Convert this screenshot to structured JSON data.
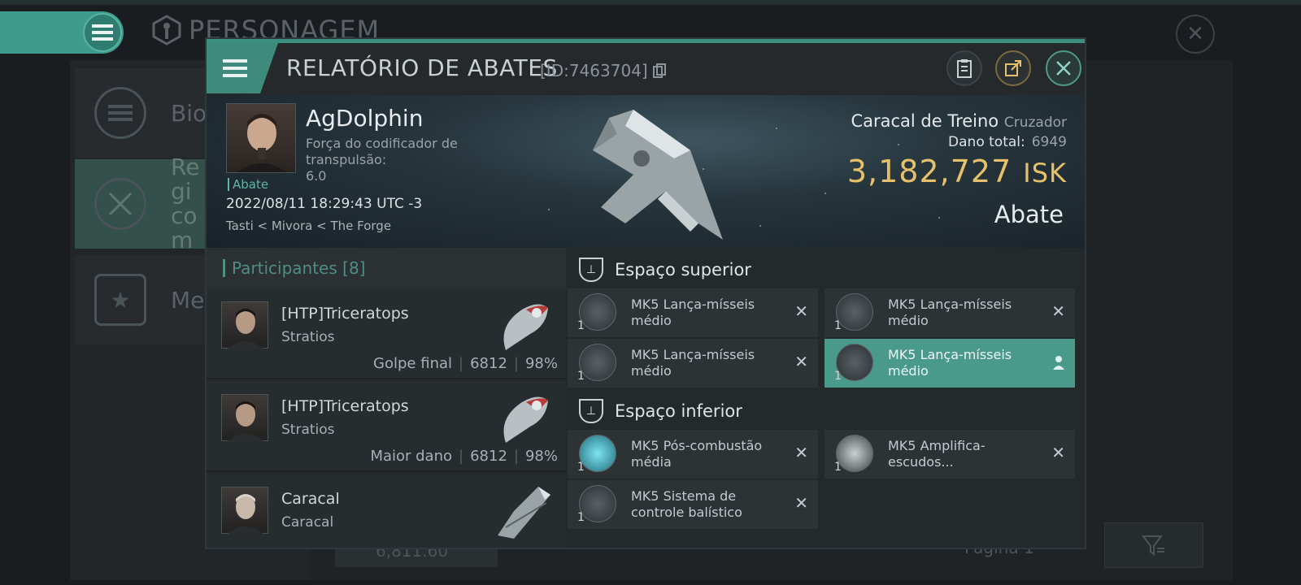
{
  "background": {
    "title": "PERSONAGEM",
    "side_items": [
      {
        "label": "Biog",
        "icon": "list-icon"
      },
      {
        "label": "Regi com",
        "icon": "swords-icon"
      },
      {
        "label": "Meda",
        "icon": "star-badge-icon"
      }
    ],
    "footer_value": "6,811.60",
    "page_label": "Página 1"
  },
  "dialog": {
    "title": "RELATÓRIO DE ABATES",
    "id_label": "[ID:7463704]",
    "victim": {
      "name": "AgDolphin",
      "strength_label": "Força do codificador de transpulsão:",
      "strength_value": "6.0",
      "tag": "Abate",
      "date": "2022/08/11 18:29:43 UTC -3",
      "location": "Tasti < Mivora < The Forge"
    },
    "ship": {
      "name": "Caracal de Treino",
      "class": "Cruzador",
      "damage_label": "Dano total:",
      "damage_value": "6949",
      "isk_value": "3,182,727",
      "isk_unit": "ISK",
      "outcome": "Abate"
    },
    "participants": {
      "label": "Participantes",
      "count": "[8]",
      "rows": [
        {
          "name": "[HTP]Triceratops",
          "ship": "Stratios",
          "role": "Golpe final",
          "damage": "6812",
          "pct": "98%"
        },
        {
          "name": "[HTP]Triceratops",
          "ship": "Stratios",
          "role": "Maior dano",
          "damage": "6812",
          "pct": "98%"
        },
        {
          "name": "Caracal",
          "ship": "Caracal",
          "role": "",
          "damage": "",
          "pct": ""
        }
      ]
    },
    "equipment": {
      "high_label": "Espaço superior",
      "low_label": "Espaço inferior",
      "high": [
        {
          "name": "MK5 Lança-mísseis médio",
          "qty": "1"
        },
        {
          "name": "MK5 Lança-mísseis médio",
          "qty": "1"
        },
        {
          "name": "MK5 Lança-mísseis médio",
          "qty": "1"
        },
        {
          "name": "MK5 Lança-mísseis médio",
          "qty": "1"
        }
      ],
      "low": [
        {
          "name": "MK5 Pós-combustão média",
          "qty": "1"
        },
        {
          "name": "MK5 Amplifica-escudos...",
          "qty": "1"
        },
        {
          "name": "MK5 Sistema de controle balístico",
          "qty": "1"
        }
      ]
    }
  }
}
